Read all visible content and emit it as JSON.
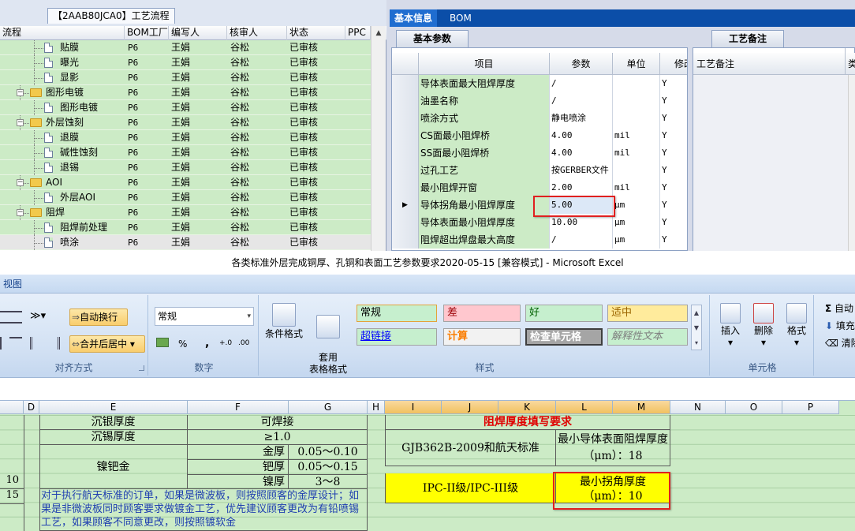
{
  "left_panel": {
    "tab_label": "【2AAB80JCA0】工艺流程",
    "columns": [
      "流程",
      "BOM工厂",
      "编写人",
      "核审人",
      "状态",
      "PPC"
    ],
    "rows": [
      {
        "name": "贴膜",
        "level": 2,
        "type": "doc",
        "bom": "P6",
        "writer": "王娟",
        "reviewer": "谷松",
        "status": "已审核"
      },
      {
        "name": "曝光",
        "level": 2,
        "type": "doc",
        "bom": "P6",
        "writer": "王娟",
        "reviewer": "谷松",
        "status": "已审核"
      },
      {
        "name": "显影",
        "level": 2,
        "type": "doc",
        "bom": "P6",
        "writer": "王娟",
        "reviewer": "谷松",
        "status": "已审核"
      },
      {
        "name": "图形电镀",
        "level": 1,
        "type": "folder",
        "bom": "P6",
        "writer": "王娟",
        "reviewer": "谷松",
        "status": "已审核"
      },
      {
        "name": "图形电镀",
        "level": 2,
        "type": "doc",
        "bom": "P6",
        "writer": "王娟",
        "reviewer": "谷松",
        "status": "已审核"
      },
      {
        "name": "外层蚀刻",
        "level": 1,
        "type": "folder",
        "bom": "P6",
        "writer": "王娟",
        "reviewer": "谷松",
        "status": "已审核"
      },
      {
        "name": "退膜",
        "level": 2,
        "type": "doc",
        "bom": "P6",
        "writer": "王娟",
        "reviewer": "谷松",
        "status": "已审核"
      },
      {
        "name": "碱性蚀刻",
        "level": 2,
        "type": "doc",
        "bom": "P6",
        "writer": "王娟",
        "reviewer": "谷松",
        "status": "已审核"
      },
      {
        "name": "退锡",
        "level": 2,
        "type": "doc",
        "bom": "P6",
        "writer": "王娟",
        "reviewer": "谷松",
        "status": "已审核"
      },
      {
        "name": "AOI",
        "level": 1,
        "type": "folder",
        "bom": "P6",
        "writer": "王娟",
        "reviewer": "谷松",
        "status": "已审核"
      },
      {
        "name": "外层AOI",
        "level": 2,
        "type": "doc",
        "bom": "P6",
        "writer": "王娟",
        "reviewer": "谷松",
        "status": "已审核"
      },
      {
        "name": "阻焊",
        "level": 1,
        "type": "folder",
        "bom": "P6",
        "writer": "王娟",
        "reviewer": "谷松",
        "status": "已审核"
      },
      {
        "name": "阻焊前处理",
        "level": 2,
        "type": "doc",
        "bom": "P6",
        "writer": "王娟",
        "reviewer": "谷松",
        "status": "已审核"
      },
      {
        "name": "喷涂",
        "level": 2,
        "type": "doc",
        "bom": "P6",
        "writer": "王娟",
        "reviewer": "谷松",
        "status": "已审核",
        "selected": true
      }
    ]
  },
  "right_panel": {
    "tabs": [
      "基本信息",
      "BOM"
    ],
    "subtab_params": "基本参数",
    "subtab_notes": "工艺备注",
    "columns": [
      "项目",
      "参数",
      "单位",
      "修改"
    ],
    "rows": [
      {
        "item": "导体表面最大阻焊厚度",
        "param": "/",
        "unit": "",
        "flag": "Y"
      },
      {
        "item": "油墨名称",
        "param": "/",
        "unit": "",
        "flag": "Y"
      },
      {
        "item": "喷涂方式",
        "param": "静电喷涂",
        "unit": "",
        "flag": "Y"
      },
      {
        "item": "CS面最小阻焊桥",
        "param": "4.00",
        "unit": "mil",
        "flag": "Y"
      },
      {
        "item": "SS面最小阻焊桥",
        "param": "4.00",
        "unit": "mil",
        "flag": "Y"
      },
      {
        "item": "过孔工艺",
        "param": "按GERBER文件",
        "unit": "",
        "flag": "Y"
      },
      {
        "item": "最小阻焊开窗",
        "param": "2.00",
        "unit": "mil",
        "flag": "Y"
      },
      {
        "item": "导体拐角最小阻焊厚度",
        "param": "5.00",
        "unit": "μm",
        "flag": "Y",
        "current": true
      },
      {
        "item": "导体表面最小阻焊厚度",
        "param": "10.00",
        "unit": "μm",
        "flag": "Y"
      },
      {
        "item": "阻焊超出焊盘最大高度",
        "param": "/",
        "unit": "μm",
        "flag": "Y"
      }
    ],
    "notes_header": "工艺备注",
    "notes_col2": "类"
  },
  "excel": {
    "title": "各类标准外层完成铜厚、孔铜和表面工艺参数要求2020-05-15  [兼容模式] - Microsoft Excel",
    "ribbon_tab": "视图",
    "alignment": {
      "wrap_text": "自动换行",
      "merge_center": "合并后居中",
      "label": "对齐方式"
    },
    "number": {
      "format": "常规",
      "percent": "%",
      "comma": ",",
      "inc": "+.0",
      "dec": ".00",
      "label": "数字"
    },
    "styles_group": {
      "conditional": "条件格式",
      "table": "套用\n表格格式",
      "label": "样式"
    },
    "styles": [
      {
        "name": "常规",
        "bg": "#c6efce",
        "color": "#000000"
      },
      {
        "name": "差",
        "bg": "#ffc7ce",
        "color": "#9c0006"
      },
      {
        "name": "好",
        "bg": "#c6efce",
        "color": "#006100"
      },
      {
        "name": "适中",
        "bg": "#ffeb9c",
        "color": "#9c6500"
      },
      {
        "name": "超链接",
        "bg": "#c6efce",
        "color": "#0000ff"
      },
      {
        "name": "计算",
        "bg": "#f2f2f2",
        "color": "#fa7d00"
      },
      {
        "name": "检查单元格",
        "bg": "#a5a5a5",
        "color": "#ffffff"
      },
      {
        "name": "解释性文本",
        "bg": "#c6efce",
        "color": "#7f7f7f"
      }
    ],
    "cells_group": {
      "insert": "插入",
      "delete": "删除",
      "format": "格式",
      "label": "单元格"
    },
    "edit_group": {
      "autosum": "自动",
      "fill": "填充",
      "clear": "清除"
    },
    "columns": [
      "D",
      "E",
      "F",
      "G",
      "H",
      "I",
      "J",
      "K",
      "L",
      "M",
      "N",
      "O",
      "P"
    ],
    "sheet": {
      "e_rows": [
        "沉银厚度",
        "沉锡厚度",
        "镍钯金"
      ],
      "f_rows": [
        "可焊接",
        "≥1.0",
        "金厚",
        "钯厚",
        "镍厚"
      ],
      "g_rows": [
        "0.05～0.10",
        "0.05～0.15",
        "3～8"
      ],
      "a_vals": [
        "10",
        "15"
      ],
      "note_text": "对于执行航天标准的订单，如果是微波板，则按照顾客的金厚设计；如果是非微波板同时顾客要求做镀金工艺，优先建议顾客更改为有铅喷锡工艺，如果顾客不同意更改，则按照镀软金",
      "solder_title": "阻焊厚度填写要求",
      "std_label": "GJB362B-2009和航天标准",
      "min_surface": "最小导体表面阻焊厚度（μm）：18",
      "ipc_label": "IPC-II级/IPC-III级",
      "min_corner": "最小拐角厚度（μm）：10"
    }
  }
}
